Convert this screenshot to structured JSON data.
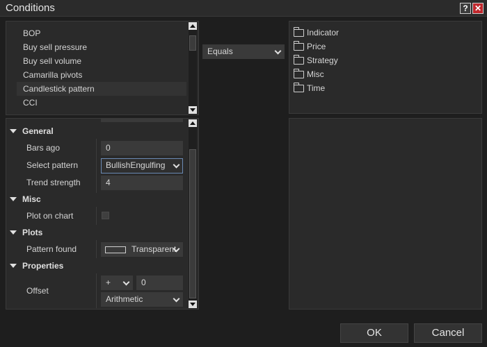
{
  "window": {
    "title": "Conditions",
    "help_label": "?",
    "close_label": "✕"
  },
  "indicators": {
    "items": [
      {
        "label": "BOP"
      },
      {
        "label": "Buy sell pressure"
      },
      {
        "label": "Buy sell volume"
      },
      {
        "label": "Camarilla pivots"
      },
      {
        "label": "Candlestick pattern"
      },
      {
        "label": "CCI"
      }
    ],
    "selected": "Candlestick pattern"
  },
  "operator": {
    "value": "Equals"
  },
  "tree": {
    "items": [
      {
        "label": "Indicator"
      },
      {
        "label": "Price"
      },
      {
        "label": "Strategy"
      },
      {
        "label": "Misc"
      },
      {
        "label": "Time"
      }
    ]
  },
  "properties": {
    "general": {
      "title": "General",
      "bars_ago": {
        "label": "Bars ago",
        "value": "0"
      },
      "select_pattern": {
        "label": "Select pattern",
        "value": "BullishEngulfing"
      },
      "trend_strength": {
        "label": "Trend strength",
        "value": "4"
      }
    },
    "misc": {
      "title": "Misc",
      "plot_on_chart": {
        "label": "Plot on chart",
        "checked": false
      }
    },
    "plots": {
      "title": "Plots",
      "pattern_found": {
        "label": "Pattern found",
        "value": "Transparent"
      }
    },
    "props": {
      "title": "Properties",
      "offset": {
        "label": "Offset",
        "sign": "+",
        "value": "0",
        "mode": "Arithmetic"
      }
    }
  },
  "buttons": {
    "ok": "OK",
    "cancel": "Cancel"
  },
  "colors": {
    "background": "#1e1e1e",
    "panel": "#2a2a2a",
    "close": "#c0282d",
    "focus_border": "#6b8bb5"
  }
}
